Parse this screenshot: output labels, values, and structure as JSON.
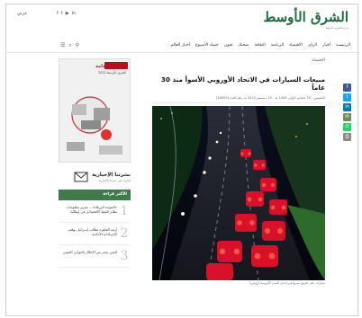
{
  "header": {
    "logo_text": "الشرق الأوسط",
    "logo_sub": "جريدة العرب الدولية",
    "language": "عربي",
    "social": [
      "f",
      "t",
      "▶",
      "in"
    ]
  },
  "nav": {
    "items": [
      "الرئيسية",
      "أخبار",
      "الرأي",
      "الاقتصاد",
      "الرياضة",
      "الثقافة",
      "صحتك",
      "فنون",
      "حصاد الأسبوع",
      "أخبار العالم"
    ],
    "tools": [
      "☰",
      "⌕",
      "⚲"
    ]
  },
  "article": {
    "breadcrumb": "الاقتصاد",
    "headline": "مبيعات السيارات في الاتحاد الأوروبي الأسوأ منذ 30 عاماً",
    "meta": "الخميس - 25 جمادى الأولى 1444 هـ - 19 ديسمبر 2022 مـ رقم العدد [16093]",
    "caption": "سيارات على طريق سريع في إحدى المدن الأوروبية (رويترز)"
  },
  "share": [
    {
      "name": "facebook",
      "glyph": "f",
      "color": "#3b5998"
    },
    {
      "name": "twitter",
      "glyph": "t",
      "color": "#1da1f2"
    },
    {
      "name": "linkedin",
      "glyph": "in",
      "color": "#0e76a8"
    },
    {
      "name": "email",
      "glyph": "✉",
      "color": "#6b8e5a"
    },
    {
      "name": "whatsapp",
      "glyph": "✆",
      "color": "#25d366"
    },
    {
      "name": "print",
      "glyph": "⎙",
      "color": "#8a8a8a"
    }
  ],
  "sidebar": {
    "ad_title": "عام الاستدامة",
    "ad_sub": "الشرق الأوسط 2022",
    "newsletter_title": "نشرتنا الإخبارية",
    "newsletter_sub": "اشترك في نشرتنا الإخبارية",
    "mostread_title": "الأكثر قراءة",
    "mostread": [
      {
        "num": "1",
        "text": "«الموجة الزرقاء»... تحرير معلومات نظام النفط الاقتصادي في إيطاليا"
      },
      {
        "num": "2",
        "text": "أزمة القاهرة تطالب إسرائيل بوقف الإجراءات الأحادية"
      },
      {
        "num": "3",
        "text": "اليمن يحذر من الإخلال بالتوازن الحوثي"
      }
    ]
  }
}
